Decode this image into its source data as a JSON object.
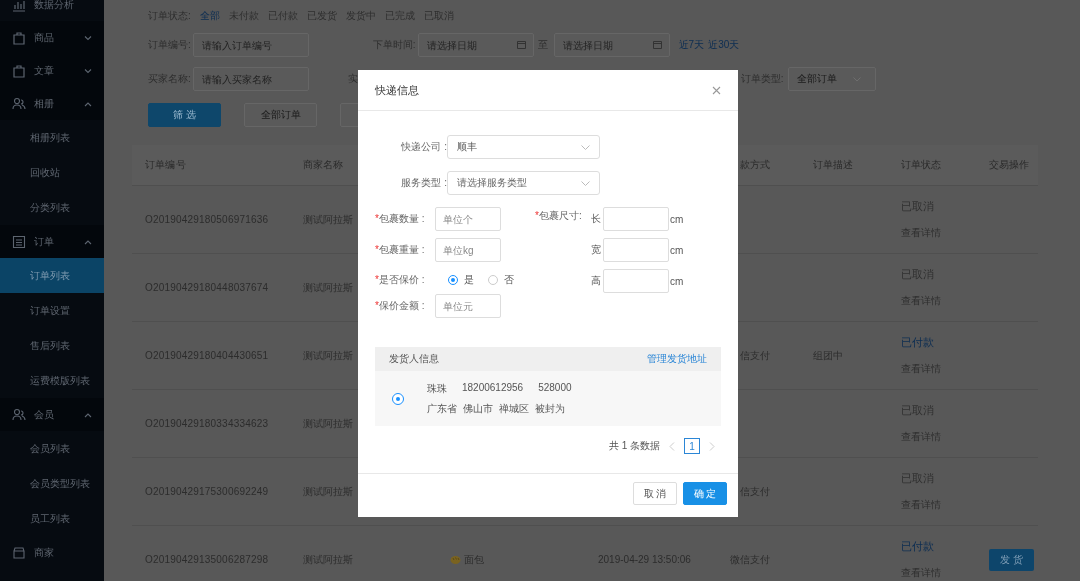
{
  "sidebar": {
    "items": [
      {
        "kind": "link",
        "label": "数据分析",
        "selected": false
      },
      {
        "kind": "group",
        "label": "商品",
        "expanded": false,
        "selected": false
      },
      {
        "kind": "group",
        "label": "文章",
        "expanded": false,
        "selected": false
      },
      {
        "kind": "group",
        "label": "相册",
        "expanded": true,
        "selected": false,
        "children": [
          {
            "label": "相册列表",
            "selected": false
          },
          {
            "label": "回收站",
            "selected": false
          },
          {
            "label": "分类列表",
            "selected": false
          }
        ]
      },
      {
        "kind": "group",
        "label": "订单",
        "expanded": true,
        "selected": false,
        "children": [
          {
            "label": "订单列表",
            "selected": true
          },
          {
            "label": "订单设置",
            "selected": false
          },
          {
            "label": "售后列表",
            "selected": false
          },
          {
            "label": "运费模版列表",
            "selected": false
          }
        ]
      },
      {
        "kind": "group",
        "label": "会员",
        "expanded": true,
        "selected": false,
        "children": [
          {
            "label": "会员列表",
            "selected": false
          },
          {
            "label": "会员类型列表",
            "selected": false
          },
          {
            "label": "员工列表",
            "selected": false
          }
        ]
      },
      {
        "kind": "link",
        "label": "商家",
        "selected": false
      }
    ]
  },
  "filters": {
    "status": {
      "label": "订单状态:",
      "options": [
        {
          "label": "全部",
          "selected": true
        },
        {
          "label": "未付款",
          "selected": false
        },
        {
          "label": "已付款",
          "selected": false
        },
        {
          "label": "已发货",
          "selected": false
        },
        {
          "label": "发货中",
          "selected": false
        },
        {
          "label": "已完成",
          "selected": false
        },
        {
          "label": "已取消",
          "selected": false
        }
      ]
    },
    "order_no": {
      "label": "订单编号:",
      "placeholder": "请输入订单编号"
    },
    "order_time": {
      "label": "下单时间:",
      "start_placeholder": "请选择日期",
      "separator": "至",
      "end_placeholder": "请选择日期",
      "quick_ranges": [
        "近7天",
        "近30天"
      ]
    },
    "buyer": {
      "label": "买家名称:",
      "placeholder": "请输入买家名称"
    },
    "partial_label": "实",
    "order_type": {
      "label": "订单类型:",
      "value": "全部订单"
    },
    "buttons": [
      {
        "label": "筛 选",
        "kind": "primary"
      },
      {
        "label": "全部订单",
        "kind": "default"
      }
    ]
  },
  "table": {
    "columns": [
      "订单编号",
      "商家名称",
      "款方式",
      "订单描述",
      "订单状态",
      "交易操作"
    ],
    "rows": [
      {
        "order_no": "O20190429180506971636",
        "merchant": "测试阿拉斯",
        "status": "已取消",
        "color": "#303030",
        "link": "查看详情"
      },
      {
        "order_no": "O20190429180448037674",
        "merchant": "测试阿拉斯",
        "status": "已取消",
        "color": "#303030",
        "link": "查看详情"
      },
      {
        "order_no": "O20190429180404430651",
        "merchant": "测试阿拉斯",
        "payment": "信支付",
        "description": "组团中",
        "status": "已付款",
        "color": "#0c2d52",
        "link": "查看详情"
      },
      {
        "order_no": "O20190429180334334623",
        "merchant": "测试阿拉斯",
        "status": "已取消",
        "color": "#303030",
        "link": "查看详情"
      },
      {
        "order_no": "O20190429175300692249",
        "merchant": "测试阿拉斯",
        "payment": "信支付",
        "status": "已取消",
        "color": "#303030",
        "link": "查看详情"
      },
      {
        "order_no": "O20190429135006287298",
        "merchant": "测试阿拉斯",
        "product": "面包",
        "time": "2019-04-29 13:50:06",
        "payment": "微信支付",
        "status": "已付款",
        "color": "#0c2d52",
        "link": "查看详情",
        "action": "发 货"
      }
    ]
  },
  "dialog": {
    "title": "快递信息",
    "courier": {
      "label": "快递公司 :",
      "value": "顺丰"
    },
    "service": {
      "label": "服务类型 :",
      "placeholder": "请选择服务类型"
    },
    "count": {
      "required_mark": "*",
      "label": "包裹数量 :",
      "placeholder": "单位个"
    },
    "weight": {
      "required_mark": "*",
      "label": "包裹重量 :",
      "placeholder": "单位kg"
    },
    "insured": {
      "required_mark": "*",
      "label": "是否保价 :",
      "options": [
        {
          "label": "是",
          "selected": true
        },
        {
          "label": "否",
          "selected": false
        }
      ]
    },
    "insured_amount": {
      "required_mark": "*",
      "label": "保价金额 :",
      "placeholder": "单位元"
    },
    "size": {
      "required_mark": "*",
      "label": "包裹尺寸:",
      "dims": [
        {
          "label": "长",
          "unit": "cm"
        },
        {
          "label": "宽",
          "unit": "cm"
        },
        {
          "label": "高",
          "unit": "cm"
        }
      ]
    },
    "sender": {
      "title": "发货人信息",
      "manage_link": "管理发货地址",
      "entries": [
        {
          "selected": true,
          "name": "珠珠",
          "phone": "18200612956",
          "zip": "528000",
          "address": [
            "广东省",
            "佛山市",
            "禅城区",
            "被封为"
          ]
        }
      ]
    },
    "pagination": {
      "total": "共 1 条数据",
      "pages": [
        {
          "label": "1",
          "selected": true
        }
      ]
    },
    "buttons": [
      {
        "label": "取 消",
        "kind": "default"
      },
      {
        "label": "确 定",
        "kind": "primary"
      }
    ]
  }
}
